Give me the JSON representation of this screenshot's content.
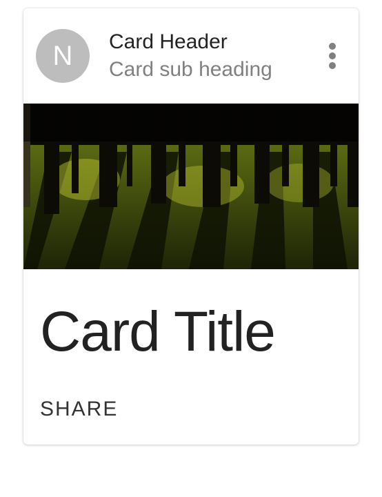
{
  "card": {
    "avatar_letter": "N",
    "header_title": "Card Header",
    "header_sub": "Card sub heading",
    "title": "Card Title",
    "share_label": "SHARE"
  }
}
